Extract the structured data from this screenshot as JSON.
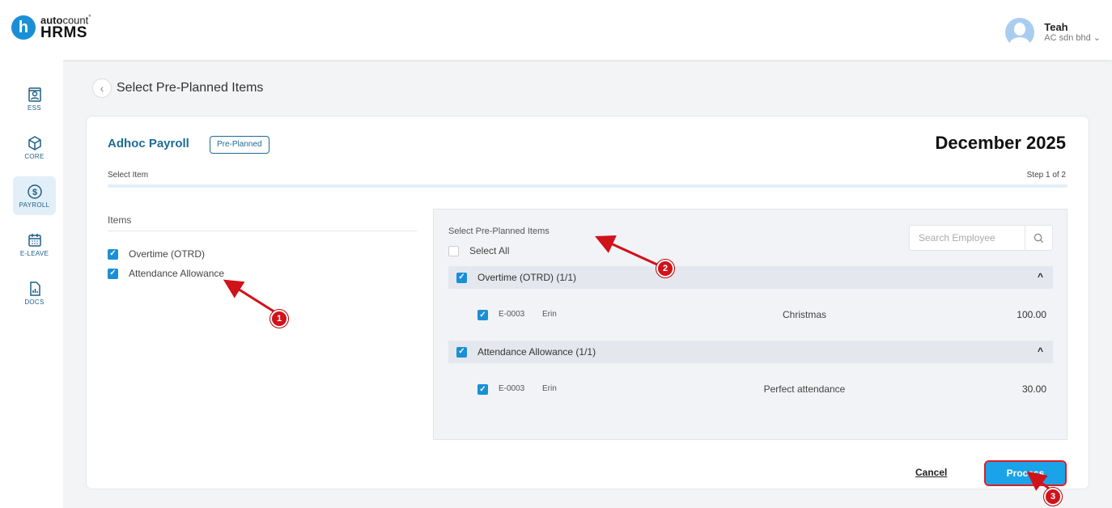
{
  "app": {
    "logo_letter": "h",
    "logo_top_bold": "auto",
    "logo_top_rest": "count",
    "logo_trademark": "°",
    "logo_bottom": "HRMS"
  },
  "user": {
    "name": "Teah",
    "company": "AC sdn bhd",
    "dropdown_icon": "chevron-down-icon"
  },
  "sidebar": {
    "items": [
      {
        "label": "ESS",
        "icon": "ess-icon",
        "active": false
      },
      {
        "label": "CORE",
        "icon": "core-icon",
        "active": false
      },
      {
        "label": "PAYROLL",
        "icon": "payroll-icon",
        "active": true
      },
      {
        "label": "E-LEAVE",
        "icon": "calendar-icon",
        "active": false
      },
      {
        "label": "DOCS",
        "icon": "docs-icon",
        "active": false
      }
    ]
  },
  "page": {
    "title": "Select Pre-Planned Items",
    "back_glyph": "‹"
  },
  "card": {
    "payroll_title": "Adhoc Payroll",
    "badge": "Pre-Planned",
    "period": "December 2025",
    "step_label": "Select Item",
    "step_count": "Step 1 of 2",
    "progress_fraction": 0.5
  },
  "items": {
    "heading": "Items",
    "list": [
      {
        "label": "Overtime (OTRD)",
        "checked": true
      },
      {
        "label": "Attendance Allowance",
        "checked": true
      }
    ]
  },
  "preplanned": {
    "title": "Select Pre-Planned Items",
    "select_all": "Select All",
    "search_placeholder": "Search Employee",
    "groups": [
      {
        "header": "Overtime (OTRD) (1/1)",
        "rows": [
          {
            "code": "E-0003",
            "name": "Erin",
            "description": "Christmas",
            "amount": "100.00"
          }
        ]
      },
      {
        "header": "Attendance Allowance (1/1)",
        "rows": [
          {
            "code": "E-0003",
            "name": "Erin",
            "description": "Perfect attendance",
            "amount": "30.00"
          }
        ]
      }
    ]
  },
  "actions": {
    "cancel": "Cancel",
    "process": "Process"
  },
  "annotations": {
    "markers": [
      "1",
      "2",
      "3"
    ],
    "color": "#d0121a"
  },
  "colors": {
    "brand": "#1a8fd6",
    "title_blue": "#1e6b96",
    "process_button": "#1aa3e8"
  }
}
